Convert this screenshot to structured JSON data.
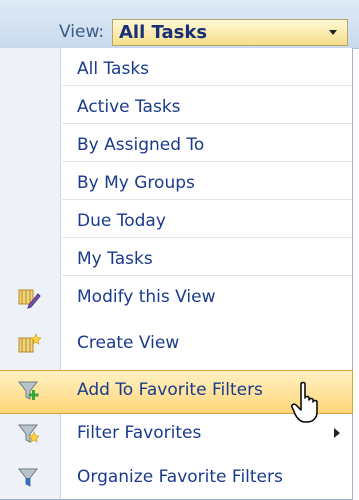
{
  "viewbar": {
    "label": "View:",
    "selected": "All Tasks"
  },
  "menu": {
    "views": [
      {
        "label": "All Tasks"
      },
      {
        "label": "Active Tasks"
      },
      {
        "label": "By Assigned To"
      },
      {
        "label": "By My Groups"
      },
      {
        "label": "Due Today"
      },
      {
        "label": "My Tasks"
      }
    ],
    "actions": [
      {
        "label": "Modify this View",
        "icon": "modify-view-icon"
      },
      {
        "label": "Create View",
        "icon": "create-view-icon"
      },
      {
        "label": "Add To Favorite Filters",
        "icon": "add-filter-icon",
        "highlighted": true
      },
      {
        "label": "Filter Favorites",
        "icon": "filter-favorites-icon",
        "has_submenu": true
      },
      {
        "label": "Organize Favorite Filters",
        "icon": "organize-filters-icon"
      }
    ]
  },
  "colors": {
    "link_text": "#1a3a8c",
    "highlight": "#ffd678",
    "viewbar_bg": "#c9daee"
  }
}
